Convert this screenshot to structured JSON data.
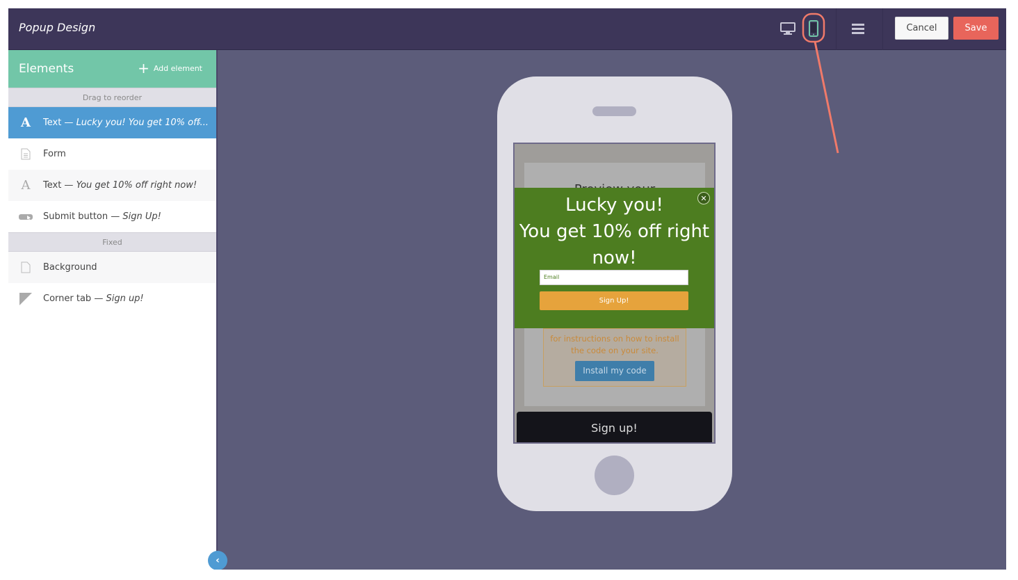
{
  "header": {
    "title": "Popup Design",
    "icons": [
      "desktop-icon",
      "mobile-icon",
      "menu-icon"
    ],
    "cancel_label": "Cancel",
    "save_label": "Save"
  },
  "sidebar": {
    "title": "Elements",
    "add_label": "Add element",
    "section_reorder": "Drag to reorder",
    "section_fixed": "Fixed",
    "items": [
      {
        "type": "Text",
        "sep": " — ",
        "detail": "Lucky you! You get 10% off...",
        "icon": "text-icon",
        "active": true
      },
      {
        "type": "Form",
        "sep": "",
        "detail": "",
        "icon": "form-icon"
      },
      {
        "type": "Text",
        "sep": " — ",
        "detail": "You get 10% off right now!",
        "icon": "text-icon"
      },
      {
        "type": "Submit button",
        "sep": " — ",
        "detail": "Sign Up!",
        "icon": "button-icon"
      }
    ],
    "fixed_items": [
      {
        "type": "Background",
        "sep": "",
        "detail": "",
        "icon": "page-icon"
      },
      {
        "type": "Corner tab",
        "sep": " — ",
        "detail": "Sign up!",
        "icon": "corner-tab-icon"
      }
    ]
  },
  "preview": {
    "page_heading": "Preview your",
    "notice_text": "for instructions on how to install the code on your site.",
    "install_label": "Install my code",
    "corner_tab_label": "Sign up!",
    "popup": {
      "line1": "Lucky you!",
      "line2": "You get 10% off right now!",
      "email_placeholder": "Email",
      "submit_label": "Sign Up!",
      "close_symbol": "✕"
    }
  },
  "colors": {
    "topbar": "#3d3659",
    "canvas": "#5c5c7a",
    "sidebar_header": "#72c6a8",
    "active_item": "#4f9bd3",
    "save": "#e8655b",
    "popup_bg": "#4d7d20",
    "popup_button": "#e6a33c",
    "annotation": "#f07a6a"
  }
}
